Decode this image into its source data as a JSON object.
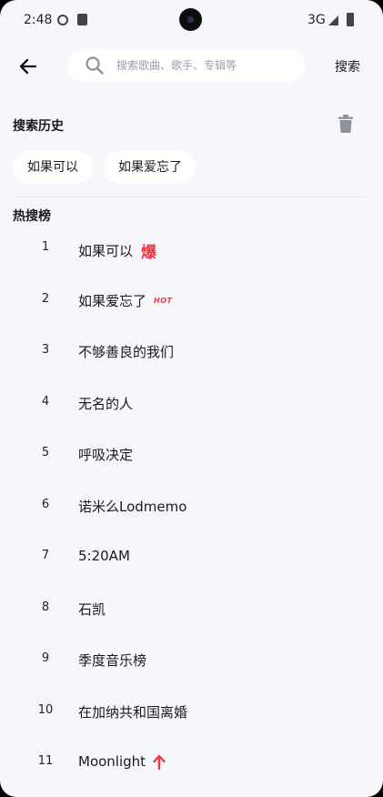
{
  "status_bar": {
    "time": "2:48",
    "network": "3G"
  },
  "search": {
    "placeholder": "搜索歌曲、歌手、专辑等",
    "value": "",
    "submit_label": "搜索"
  },
  "history": {
    "title": "搜索历史",
    "items": [
      "如果可以",
      "如果爱忘了"
    ]
  },
  "hot": {
    "title": "热搜榜",
    "items": [
      {
        "rank": "1",
        "name": "如果可以",
        "badge": "爆"
      },
      {
        "rank": "2",
        "name": "如果爱忘了",
        "badge": "HOT"
      },
      {
        "rank": "3",
        "name": "不够善良的我们",
        "badge": ""
      },
      {
        "rank": "4",
        "name": "无名的人",
        "badge": ""
      },
      {
        "rank": "5",
        "name": "呼吸决定",
        "badge": ""
      },
      {
        "rank": "6",
        "name": "诺米么Lodmemo",
        "badge": ""
      },
      {
        "rank": "7",
        "name": "5:20AM",
        "badge": ""
      },
      {
        "rank": "8",
        "name": "石凯",
        "badge": ""
      },
      {
        "rank": "9",
        "name": "季度音乐榜",
        "badge": ""
      },
      {
        "rank": "10",
        "name": "在加纳共和国离婚",
        "badge": ""
      },
      {
        "rank": "11",
        "name": "Moonlight",
        "badge": "up-arrow"
      }
    ]
  },
  "colors": {
    "background": "#f5f7fc",
    "accent_red": "#f2363f",
    "icon_gray": "#8e9199"
  }
}
